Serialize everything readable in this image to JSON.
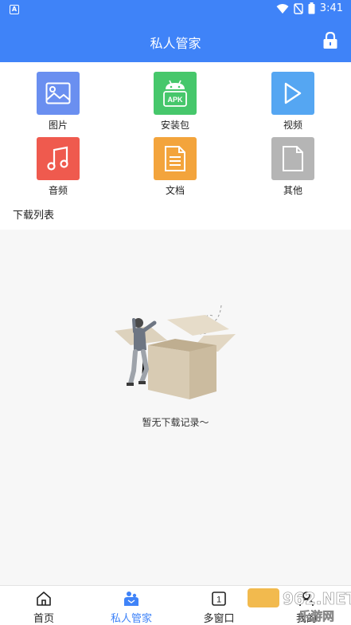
{
  "status_bar": {
    "app_indicator": "A",
    "time": "3:41",
    "icons": [
      "wifi-icon",
      "signal-off-icon",
      "battery-icon"
    ]
  },
  "header": {
    "title": "私人管家",
    "lock_icon": "lock-icon"
  },
  "categories": [
    {
      "label": "图片",
      "icon": "image-icon",
      "color": "#6a8ff0"
    },
    {
      "label": "安装包",
      "icon": "apk-icon",
      "color": "#46c76b",
      "badge": "APK"
    },
    {
      "label": "视频",
      "icon": "play-icon",
      "color": "#55a6f2"
    },
    {
      "label": "音频",
      "icon": "music-icon",
      "color": "#ef5a4e"
    },
    {
      "label": "文档",
      "icon": "document-icon",
      "color": "#f3a43c"
    },
    {
      "label": "其他",
      "icon": "file-icon",
      "color": "#b5b5b5"
    }
  ],
  "download_list": {
    "title": "下载列表",
    "empty_message": "暂无下载记录～"
  },
  "bottom_nav": [
    {
      "label": "首页",
      "icon": "home-icon",
      "active": false
    },
    {
      "label": "私人管家",
      "icon": "butler-icon",
      "active": true
    },
    {
      "label": "多窗口",
      "icon": "window-count-icon",
      "count": "1",
      "active": false
    },
    {
      "label": "我的",
      "icon": "profile-icon",
      "active": false
    }
  ],
  "watermark": {
    "text_top": "962.NET",
    "text_bottom": "乐游网"
  },
  "colors": {
    "primary": "#3f83f8",
    "background": "#f7f7f7"
  }
}
